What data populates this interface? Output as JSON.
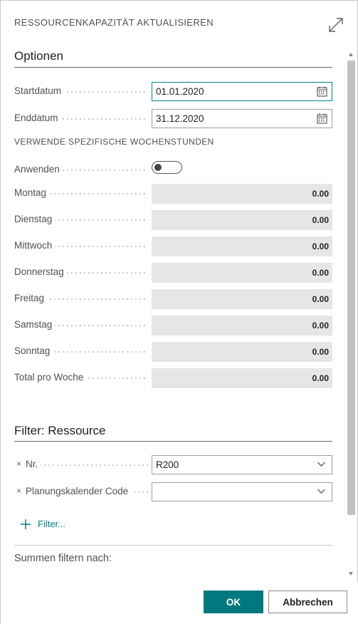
{
  "dialog": {
    "title": "RESSOURCENKAPAZITÄT AKTUALISIEREN",
    "expand_icon": "expand-icon"
  },
  "options": {
    "heading": "Optionen",
    "start_label": "Startdatum",
    "start_value": "01.01.2020",
    "end_label": "Enddatum",
    "end_value": "31.12.2020",
    "calendar_icon": "calendar-icon",
    "subheading": "VERWENDE SPEZIFISCHE WOCHENSTUNDEN",
    "apply_label": "Anwenden",
    "apply_on": false,
    "weekdays": [
      {
        "label": "Montag",
        "value": "0.00"
      },
      {
        "label": "Dienstag",
        "value": "0.00"
      },
      {
        "label": "Mittwoch",
        "value": "0.00"
      },
      {
        "label": "Donnerstag",
        "value": "0.00"
      },
      {
        "label": "Freitag",
        "value": "0.00"
      },
      {
        "label": "Samstag",
        "value": "0.00"
      },
      {
        "label": "Sonntag",
        "value": "0.00"
      },
      {
        "label": "Total pro Woche",
        "value": "0.00"
      }
    ]
  },
  "filter": {
    "heading": "Filter: Ressource",
    "rows": [
      {
        "label": "Nr.",
        "value": "R200"
      },
      {
        "label": "Planungskalender Code",
        "value": ""
      }
    ],
    "remove_icon": "×",
    "add_label": "Filter...",
    "sum_label": "Summen filtern nach:"
  },
  "buttons": {
    "ok": "OK",
    "cancel": "Abbrechen"
  },
  "colors": {
    "accent": "#00797e",
    "readonly_bg": "#e6e6e6"
  }
}
